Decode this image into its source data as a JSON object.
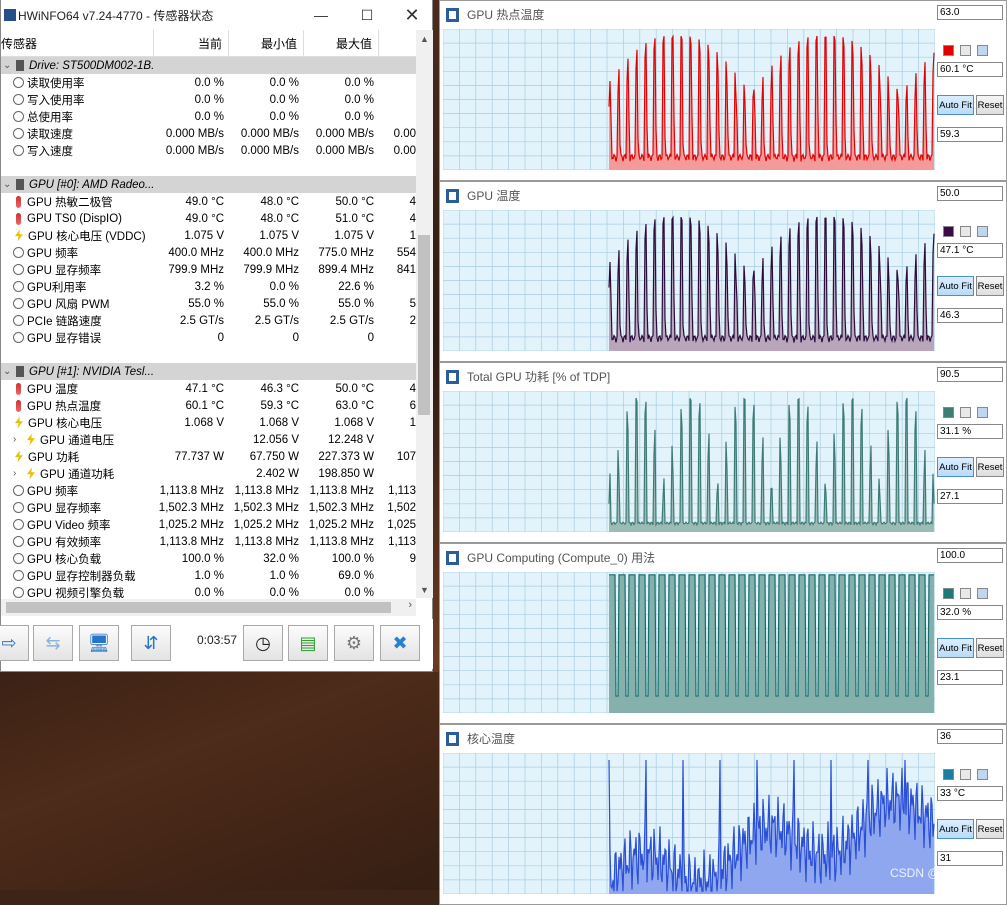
{
  "main_window": {
    "title": "HWiNFO64 v7.24-4770 - 传感器状态",
    "columns": [
      "传感器",
      "当前",
      "最小值",
      "最大值"
    ],
    "rows": [
      {
        "type": "group",
        "icon": "drive-icon",
        "name": "Drive: ST500DM002-1B..."
      },
      {
        "type": "sensor",
        "icon": "clock-icon",
        "name": "读取使用率",
        "cur": "0.0 %",
        "min": "0.0 %",
        "max": "0.0 %",
        "avg": ""
      },
      {
        "type": "sensor",
        "icon": "clock-icon",
        "name": "写入使用率",
        "cur": "0.0 %",
        "min": "0.0 %",
        "max": "0.0 %",
        "avg": ""
      },
      {
        "type": "sensor",
        "icon": "clock-icon",
        "name": "总使用率",
        "cur": "0.0 %",
        "min": "0.0 %",
        "max": "0.0 %",
        "avg": ""
      },
      {
        "type": "sensor",
        "icon": "clock-icon",
        "name": "读取速度",
        "cur": "0.000 MB/s",
        "min": "0.000 MB/s",
        "max": "0.000 MB/s",
        "avg": "0.00"
      },
      {
        "type": "sensor",
        "icon": "clock-icon",
        "name": "写入速度",
        "cur": "0.000 MB/s",
        "min": "0.000 MB/s",
        "max": "0.000 MB/s",
        "avg": "0.00"
      },
      {
        "type": "blank"
      },
      {
        "type": "group",
        "icon": "gpu-icon",
        "name": "GPU [#0]: AMD Radeo..."
      },
      {
        "type": "sensor",
        "icon": "thermometer-icon",
        "name": "GPU 热敏二极管",
        "cur": "49.0 °C",
        "min": "48.0 °C",
        "max": "50.0 °C",
        "avg": "4"
      },
      {
        "type": "sensor",
        "icon": "thermometer-icon",
        "name": "GPU TS0 (DispIO)",
        "cur": "49.0 °C",
        "min": "48.0 °C",
        "max": "51.0 °C",
        "avg": "4"
      },
      {
        "type": "sensor",
        "icon": "bolt-icon",
        "name": "GPU 核心电压 (VDDC)",
        "cur": "1.075 V",
        "min": "1.075 V",
        "max": "1.075 V",
        "avg": "1"
      },
      {
        "type": "sensor",
        "icon": "clock-icon",
        "name": "GPU 频率",
        "cur": "400.0 MHz",
        "min": "400.0 MHz",
        "max": "775.0 MHz",
        "avg": "554"
      },
      {
        "type": "sensor",
        "icon": "clock-icon",
        "name": "GPU 显存频率",
        "cur": "799.9 MHz",
        "min": "799.9 MHz",
        "max": "899.4 MHz",
        "avg": "841"
      },
      {
        "type": "sensor",
        "icon": "clock-icon",
        "name": "GPU利用率",
        "cur": "3.2 %",
        "min": "0.0 %",
        "max": "22.6 %",
        "avg": ""
      },
      {
        "type": "sensor",
        "icon": "clock-icon",
        "name": "GPU 风扇 PWM",
        "cur": "55.0 %",
        "min": "55.0 %",
        "max": "55.0 %",
        "avg": "5"
      },
      {
        "type": "sensor",
        "icon": "clock-icon",
        "name": "PCIe 链路速度",
        "cur": "2.5 GT/s",
        "min": "2.5 GT/s",
        "max": "2.5 GT/s",
        "avg": "2"
      },
      {
        "type": "sensor",
        "icon": "clock-icon",
        "name": "GPU 显存错误",
        "cur": "0",
        "min": "0",
        "max": "0",
        "avg": ""
      },
      {
        "type": "blank"
      },
      {
        "type": "group",
        "icon": "gpu-icon",
        "name": "GPU [#1]: NVIDIA Tesl..."
      },
      {
        "type": "sensor",
        "icon": "thermometer-icon",
        "name": "GPU 温度",
        "cur": "47.1 °C",
        "min": "46.3 °C",
        "max": "50.0 °C",
        "avg": "4"
      },
      {
        "type": "sensor",
        "icon": "thermometer-icon",
        "name": "GPU 热点温度",
        "cur": "60.1 °C",
        "min": "59.3 °C",
        "max": "63.0 °C",
        "avg": "6"
      },
      {
        "type": "sensor",
        "icon": "bolt-icon",
        "name": "GPU 核心电压",
        "cur": "1.068 V",
        "min": "1.068 V",
        "max": "1.068 V",
        "avg": "1"
      },
      {
        "type": "sub",
        "icon": "bolt-icon",
        "name": "GPU 通道电压",
        "cur": "",
        "min": "12.056 V",
        "max": "12.248 V",
        "avg": ""
      },
      {
        "type": "sensor",
        "icon": "bolt-icon",
        "name": "GPU 功耗",
        "cur": "77.737 W",
        "min": "67.750 W",
        "max": "227.373 W",
        "avg": "107"
      },
      {
        "type": "sub",
        "icon": "bolt-icon",
        "name": "GPU 通道功耗",
        "cur": "",
        "min": "2.402 W",
        "max": "198.850 W",
        "avg": ""
      },
      {
        "type": "sensor",
        "icon": "clock-icon",
        "name": "GPU 频率",
        "cur": "1,113.8 MHz",
        "min": "1,113.8 MHz",
        "max": "1,113.8 MHz",
        "avg": "1,113"
      },
      {
        "type": "sensor",
        "icon": "clock-icon",
        "name": "GPU 显存频率",
        "cur": "1,502.3 MHz",
        "min": "1,502.3 MHz",
        "max": "1,502.3 MHz",
        "avg": "1,502"
      },
      {
        "type": "sensor",
        "icon": "clock-icon",
        "name": "GPU Video 频率",
        "cur": "1,025.2 MHz",
        "min": "1,025.2 MHz",
        "max": "1,025.2 MHz",
        "avg": "1,025"
      },
      {
        "type": "sensor",
        "icon": "clock-icon",
        "name": "GPU 有效频率",
        "cur": "1,113.8 MHz",
        "min": "1,113.8 MHz",
        "max": "1,113.8 MHz",
        "avg": "1,113"
      },
      {
        "type": "sensor",
        "icon": "clock-icon",
        "name": "GPU 核心负载",
        "cur": "100.0 %",
        "min": "32.0 %",
        "max": "100.0 %",
        "avg": "9"
      },
      {
        "type": "sensor",
        "icon": "clock-icon",
        "name": "GPU 显存控制器负载",
        "cur": "1.0 %",
        "min": "1.0 %",
        "max": "69.0 %",
        "avg": ""
      },
      {
        "type": "sensor",
        "icon": "clock-icon",
        "name": "GPU 视频引擎负载",
        "cur": "0.0 %",
        "min": "0.0 %",
        "max": "0.0 %",
        "avg": ""
      }
    ],
    "timer": "0:03:57"
  },
  "graphs": [
    {
      "title": "GPU 热点温度",
      "max": "63.0",
      "current": "60.1 °C",
      "min": "59.3",
      "color": "#e30000",
      "fill": "#f59a9a",
      "swatch": "#e00000",
      "pattern": "spiky"
    },
    {
      "title": "GPU 温度",
      "max": "50.0",
      "current": "47.1 °C",
      "min": "46.3",
      "color": "#2b0c3a",
      "fill": "#b9a6bd",
      "swatch": "#3a0a4a",
      "pattern": "spiky"
    },
    {
      "title": "Total GPU 功耗 [% of TDP]",
      "max": "90.5",
      "current": "31.1 %",
      "min": "27.1",
      "color": "#3e7a74",
      "fill": "#9dbbb5",
      "swatch": "#3c7d74",
      "pattern": "sparse"
    },
    {
      "title": "GPU Computing (Compute_0) 用法",
      "max": "100.0",
      "current": "32.0 %",
      "min": "23.1",
      "color": "#146e6b",
      "fill": "#86b0ab",
      "swatch": "#1a7c78",
      "pattern": "square"
    },
    {
      "title": "核心温度",
      "max": "36",
      "current": "33 °C",
      "min": "31",
      "color": "#2a4fd6",
      "fill": "#8ea7ee",
      "swatch": "#1c7fa2",
      "pattern": "ramp"
    }
  ],
  "buttons": {
    "auto_fit": "Auto Fit",
    "reset": "Reset"
  },
  "watermark": "CSDN @里先森"
}
